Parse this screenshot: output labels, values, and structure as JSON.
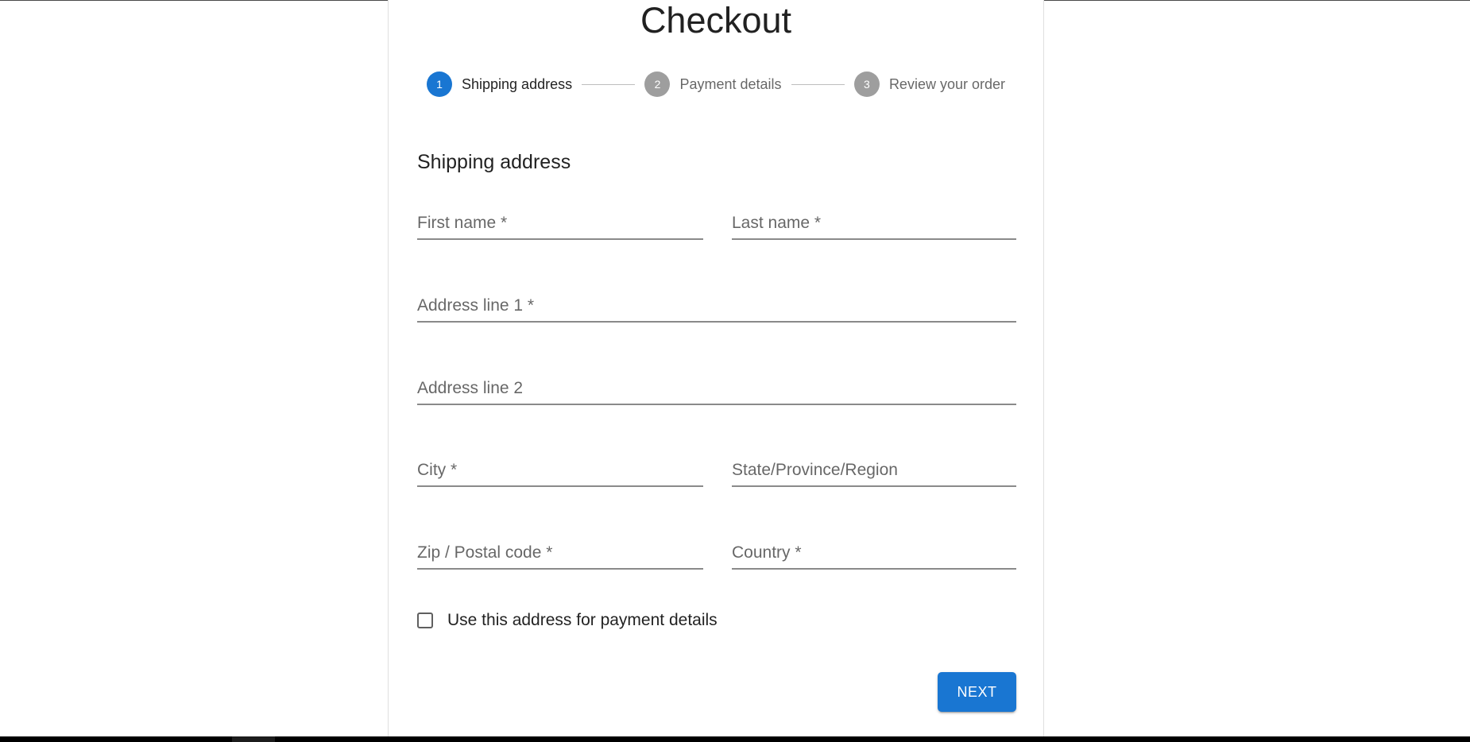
{
  "page": {
    "title": "Checkout",
    "accent_color": "#1976d2",
    "inactive_step_color": "#9e9e9e"
  },
  "stepper": {
    "active_index": 0,
    "steps": [
      {
        "number": "1",
        "label": "Shipping address"
      },
      {
        "number": "2",
        "label": "Payment details"
      },
      {
        "number": "3",
        "label": "Review your order"
      }
    ]
  },
  "form": {
    "section_title": "Shipping address",
    "fields": {
      "first_name": {
        "label": "First name *",
        "value": ""
      },
      "last_name": {
        "label": "Last name *",
        "value": ""
      },
      "address1": {
        "label": "Address line 1 *",
        "value": ""
      },
      "address2": {
        "label": "Address line 2",
        "value": ""
      },
      "city": {
        "label": "City *",
        "value": ""
      },
      "state": {
        "label": "State/Province/Region",
        "value": ""
      },
      "zip": {
        "label": "Zip / Postal code *",
        "value": ""
      },
      "country": {
        "label": "Country *",
        "value": ""
      }
    },
    "save_address": {
      "label": "Use this address for payment details",
      "checked": false
    }
  },
  "actions": {
    "next_label": "NEXT"
  }
}
